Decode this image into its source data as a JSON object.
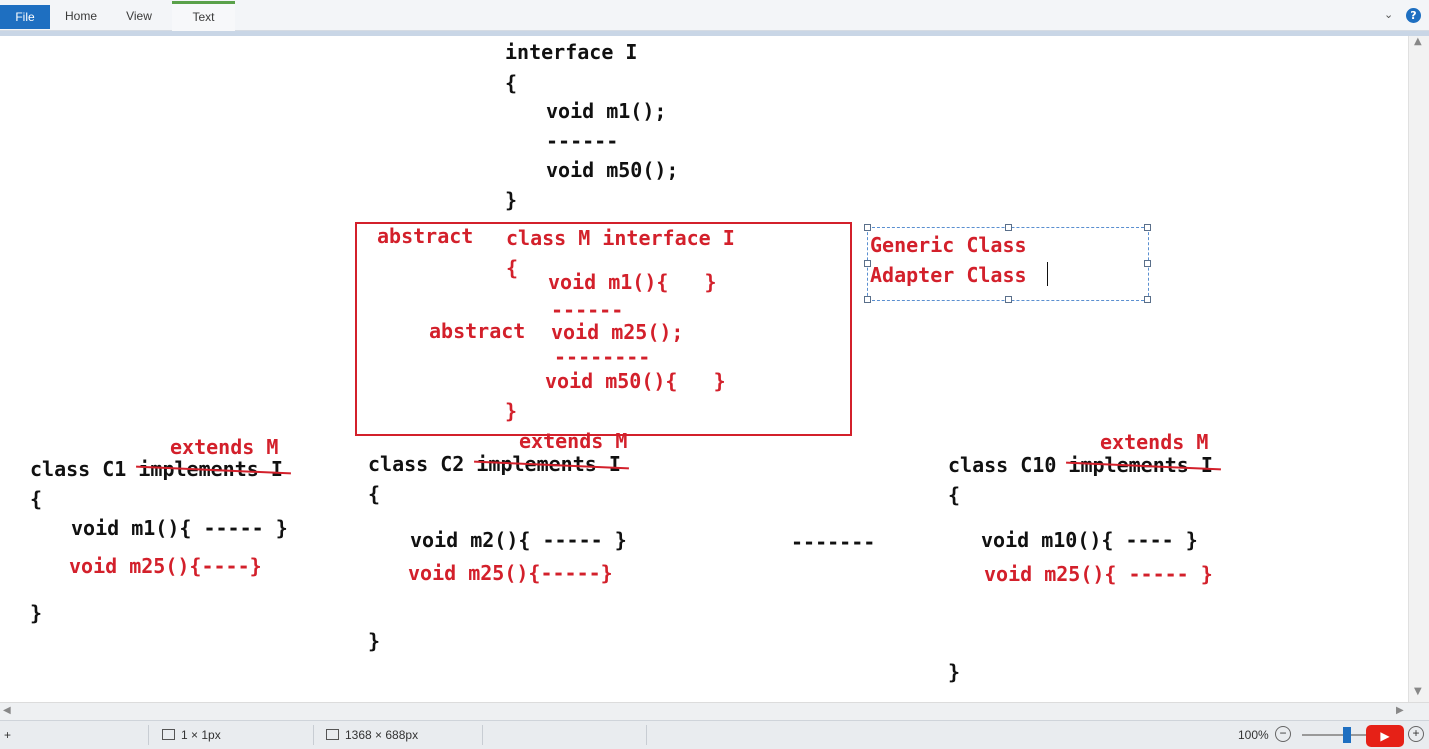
{
  "ribbon": {
    "tabs": [
      {
        "label": "File"
      },
      {
        "label": "Home"
      },
      {
        "label": "View"
      },
      {
        "label": "Text"
      }
    ],
    "collapse_icon": "chevron-down-icon",
    "help_label": "?"
  },
  "canvas": {
    "interface_block": {
      "line1": "interface I",
      "line2": "{",
      "line3": "void m1();",
      "line4": "------",
      "line5": "void m50();",
      "line6": "}"
    },
    "abstract_block": {
      "abstract1": "abstract",
      "header": "class M interface I",
      "brace_open": "{",
      "m1": "void m1(){   }",
      "dash1": "------",
      "abstract2": "abstract",
      "m25": "void m25();",
      "dash2": "--------",
      "m50": "void m50(){   }",
      "brace_close": "}"
    },
    "notes": {
      "line1": "Generic Class",
      "line2": "Adapter Class"
    },
    "c1": {
      "extends": "extends M",
      "header_prefix": "class C1 ",
      "implements": "implements I",
      "brace_open": "{",
      "m1": "void m1(){ ----- }",
      "m25": "void m25(){----}",
      "brace_close": "}"
    },
    "c2": {
      "extends": "extends M",
      "header_prefix": "class C2 ",
      "implements": "implements I",
      "brace_open": "{",
      "m2": "void m2(){ ----- }",
      "m25": "void m25(){-----}",
      "brace_close": "}"
    },
    "middle_dashes": "-------",
    "c10": {
      "extends": "extends M",
      "header_prefix": "class C10 ",
      "implements": "implements I",
      "brace_open": "{",
      "m10": "void m10(){ ---- }",
      "m25": "void m25(){ ----- }",
      "brace_close": "}"
    }
  },
  "status_bar": {
    "selection_size": "1 × 1px",
    "image_size": "1368 × 688px",
    "zoom": "100%",
    "zoom_out": "−",
    "zoom_in": "+",
    "play_icon": "play-icon"
  },
  "colors": {
    "accent_red": "#d3202b",
    "file_tab": "#1e6fc1"
  }
}
